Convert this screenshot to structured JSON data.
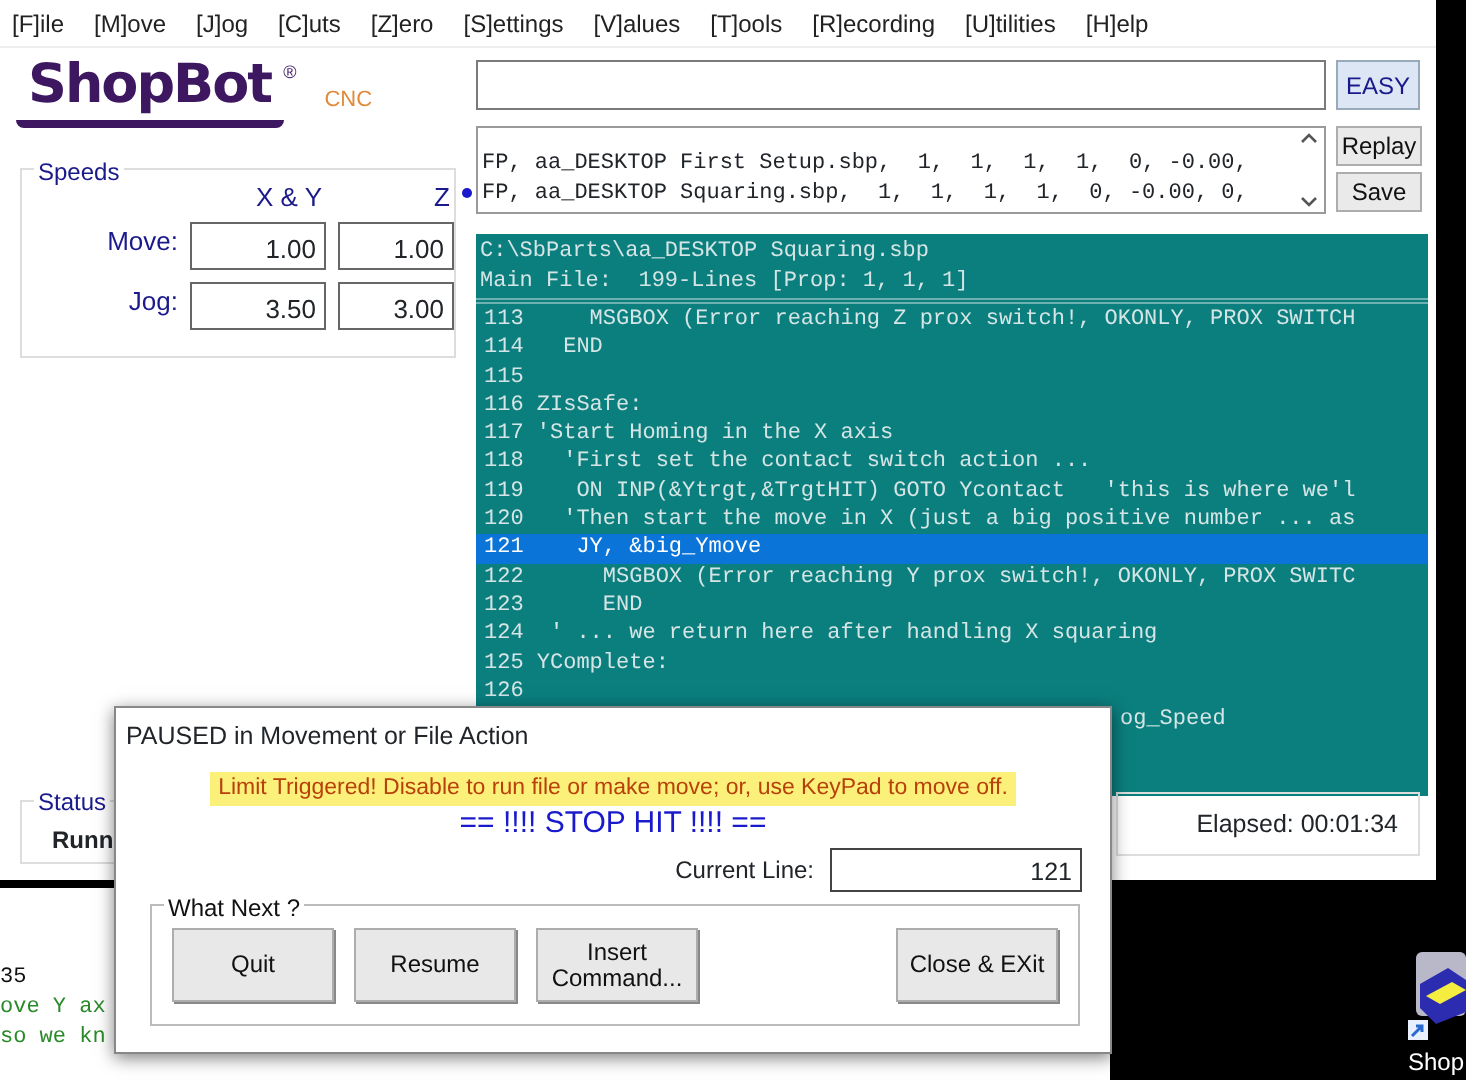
{
  "menu": [
    "[F]ile",
    "[M]ove",
    "[J]og",
    "[C]uts",
    "[Z]ero",
    "[S]ettings",
    "[V]alues",
    "[T]ools",
    "[R]ecording",
    "[U]tilities",
    "[H]elp"
  ],
  "logo": {
    "name": "ShopBot",
    "mark": "®",
    "tag": "CNC"
  },
  "easy_button": "EASY",
  "file_history": {
    "rows": [
      {
        "text": "FP, aa_DESKTOP First Setup.sbp,  1,  1,  1,  1,  0, -0.00,",
        "current": false
      },
      {
        "text": "FP, aa_DESKTOP Squaring.sbp,  1,  1,  1,  1,  0, -0.00, 0,",
        "current": true
      }
    ],
    "buttons": [
      "Replay",
      "Save"
    ]
  },
  "speeds": {
    "title": "Speeds",
    "columns": [
      "X & Y",
      "Z"
    ],
    "rows": [
      {
        "label": "Move:",
        "values": [
          "1.00",
          "1.00"
        ]
      },
      {
        "label": "Jog:",
        "values": [
          "3.50",
          "3.00"
        ]
      }
    ]
  },
  "code_panel": {
    "path": "C:\\SbParts\\aa_DESKTOP Squaring.sbp",
    "main_file": "Main File:  199-Lines [Prop: 1, 1, 1]",
    "lines": [
      {
        "number": "113",
        "text": "    MSGBOX (Error reaching Z prox switch!, OKONLY, PROX SWITCH",
        "selected": false
      },
      {
        "number": "114",
        "text": "  END",
        "selected": false
      },
      {
        "number": "115",
        "selected": false
      },
      {
        "number": "116",
        "text": "ZIsSafe:",
        "selected": false
      },
      {
        "number": "117",
        "text": "'Start Homing in the X axis",
        "selected": false
      },
      {
        "number": "118",
        "text": "  'First set the contact switch action ...",
        "selected": false
      },
      {
        "number": "119",
        "text": "   ON INP(&Ytrgt,&TrgtHIT) GOTO Ycontact   'this is where we'l",
        "selected": false
      },
      {
        "number": "120",
        "text": "  'Then start the move in X (just a big positive number ... as",
        "selected": false
      },
      {
        "number": "121",
        "text": "   JY, &big_Ymove",
        "selected": true
      },
      {
        "number": "122",
        "text": "     MSGBOX (Error reaching Y prox switch!, OKONLY, PROX SWITC",
        "selected": false
      },
      {
        "number": "123",
        "text": "     END",
        "selected": false
      },
      {
        "number": "124",
        "text": " ' ... we return here after handling X squaring",
        "selected": false
      },
      {
        "number": "125",
        "text": "YComplete:",
        "selected": false
      },
      {
        "number": "126",
        "selected": false
      }
    ],
    "partial_line": "og_Speed"
  },
  "status": {
    "title": "Status",
    "value": "Runn"
  },
  "elapsed": "Elapsed: 00:01:34",
  "background_window": {
    "lines": [
      {
        "text": "35",
        "kind": "plain"
      },
      {
        "text": "ove Y ax",
        "kind": "comment"
      },
      {
        "text": "so we kn",
        "kind": "comment"
      }
    ]
  },
  "dialog": {
    "title": "PAUSED in Movement or File Action",
    "warning": "Limit Triggered! Disable to run file or make move; or, use KeyPad to move off.",
    "alert": "== !!!! STOP HIT !!!! ==",
    "current_line": {
      "label": "Current Line:",
      "value": "121"
    },
    "group_title": "What Next ?",
    "buttons": [
      "Quit",
      "Resume",
      "Insert Command...",
      "Close & EXit"
    ]
  },
  "desktop_icon": {
    "label": "Shop"
  }
}
